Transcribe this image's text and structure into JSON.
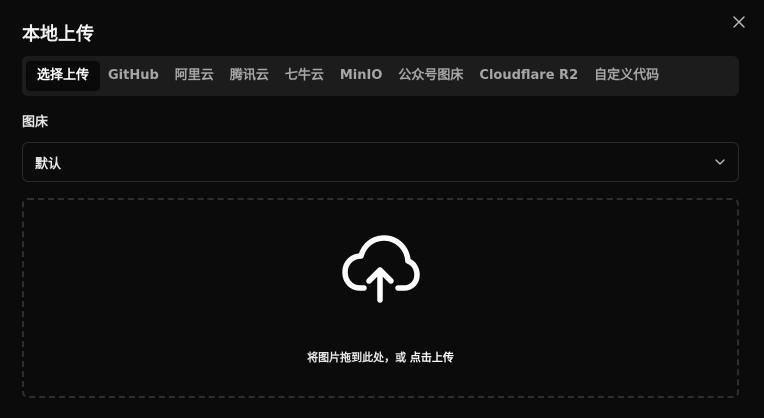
{
  "dialog": {
    "title": "本地上传",
    "close_icon": "close-icon"
  },
  "tabs": [
    {
      "label": "选择上传",
      "active": true
    },
    {
      "label": "GitHub",
      "active": false
    },
    {
      "label": "阿里云",
      "active": false
    },
    {
      "label": "腾讯云",
      "active": false
    },
    {
      "label": "七牛云",
      "active": false
    },
    {
      "label": "MinIO",
      "active": false
    },
    {
      "label": "公众号图床",
      "active": false
    },
    {
      "label": "Cloudflare R2",
      "active": false
    },
    {
      "label": "自定义代码",
      "active": false
    }
  ],
  "image_host": {
    "label": "图床",
    "selected": "默认",
    "icon": "chevron-down-icon"
  },
  "dropzone": {
    "icon": "cloud-upload-icon",
    "text_prefix": "将图片拖到此处，或 ",
    "text_link": "点击上传"
  },
  "colors": {
    "background": "#0b0b0b",
    "tab_bar": "#1c1c1c",
    "active_tab": "#0a0a0a",
    "border": "#2a2a2a"
  }
}
